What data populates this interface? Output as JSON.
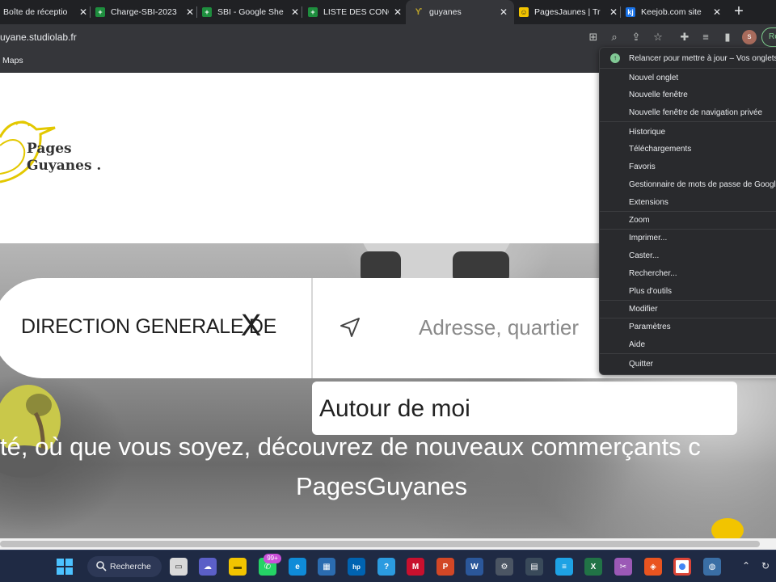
{
  "tabs": [
    {
      "title": "Boîte de réceptio",
      "icon": "gmail-icon",
      "color": "#ea4335"
    },
    {
      "title": "Charge-SBI-2023",
      "icon": "sheets-icon",
      "color": "#1e8e3e"
    },
    {
      "title": "SBI - Google She",
      "icon": "sheets-icon",
      "color": "#1e8e3e"
    },
    {
      "title": "LISTE DES CONC",
      "icon": "sheets-icon",
      "color": "#1e8e3e"
    },
    {
      "title": "guyanes",
      "icon": "bird-icon",
      "color": "#b9a02a"
    },
    {
      "title": "PagesJaunes | Tr",
      "icon": "pagesjaunes-icon",
      "color": "#f2c400"
    },
    {
      "title": "Keejob.com site",
      "icon": "keejob-icon",
      "color": "#1a73e8"
    }
  ],
  "toolbar": {
    "url": "uyane.studiolab.fr",
    "avatar_letter": "s",
    "update_label": "Re"
  },
  "bookmarks": {
    "maps": "Maps"
  },
  "logo": {
    "line1": "Pages",
    "line2": "Guyanes ."
  },
  "search": {
    "query": "DIRECTION GENERALE DE",
    "clear_symbol": "X",
    "address_placeholder": "Adresse, quartier",
    "around_me": "Autour de moi"
  },
  "tagline": {
    "line1": "té, où que vous soyez, découvrez de nouveaux commerçants c",
    "line2": "PagesGuyanes"
  },
  "menu": {
    "update": "Relancer pour mettre à jour – Vos onglets",
    "items": [
      "Nouvel onglet",
      "Nouvelle fenêtre",
      "Nouvelle fenêtre de navigation privée",
      "Historique",
      "Téléchargements",
      "Favoris",
      "Gestionnaire de mots de passe de Google",
      "Extensions",
      "Zoom",
      "Imprimer...",
      "Caster...",
      "Rechercher...",
      "Plus d'outils",
      "Modifier",
      "Paramètres",
      "Aide",
      "Quitter"
    ]
  },
  "taskbar": {
    "search_label": "Recherche",
    "whatsapp_badge": "99+"
  }
}
